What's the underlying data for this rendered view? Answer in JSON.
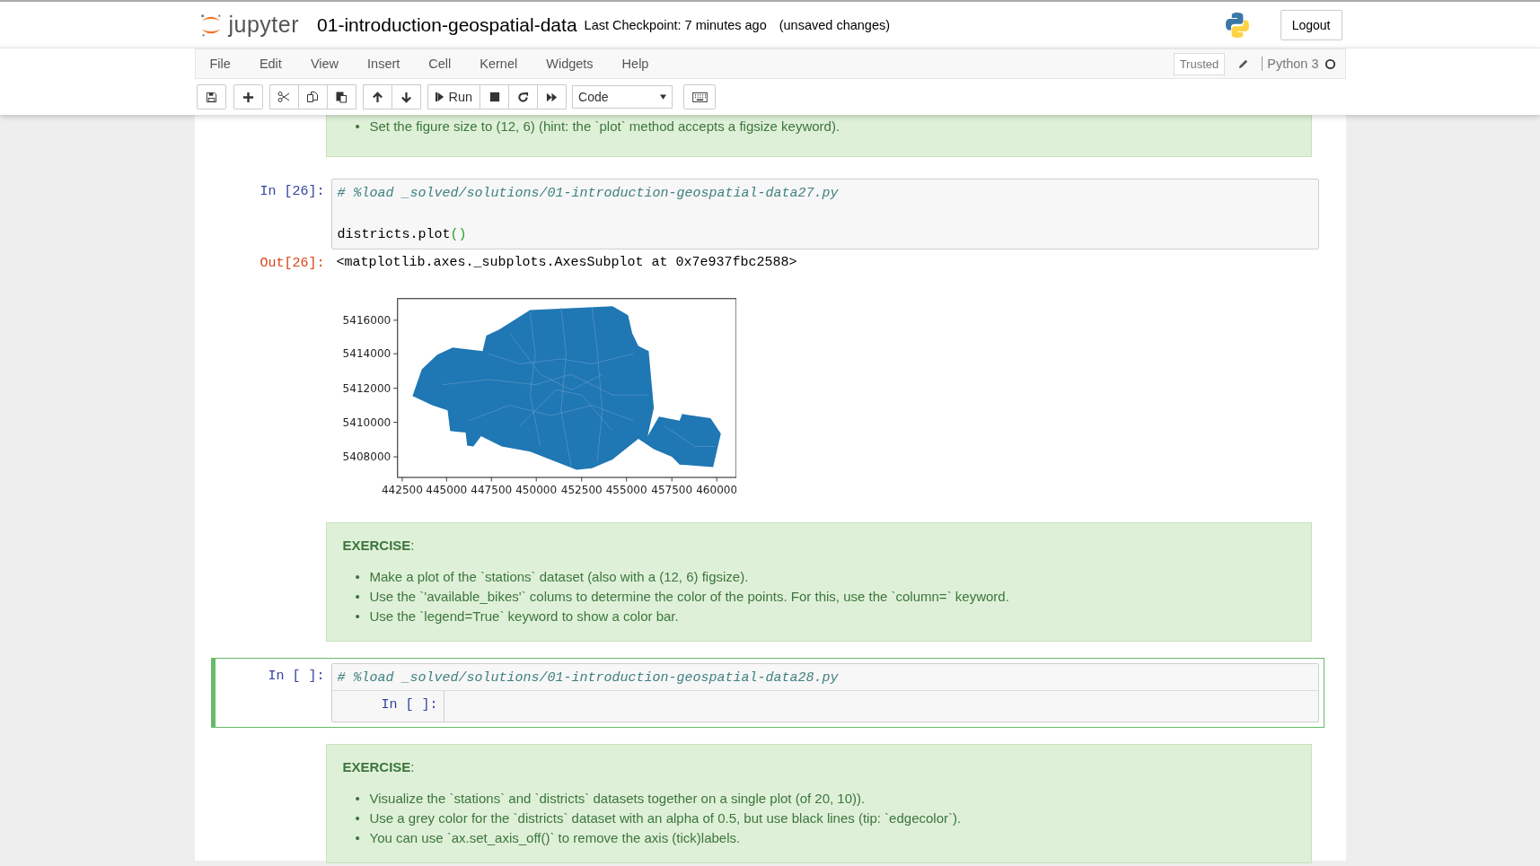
{
  "header": {
    "logo_text": "jupyter",
    "notebook_title": "01-introduction-geospatial-data",
    "checkpoint": "Last Checkpoint: 7 minutes ago",
    "unsaved": "(unsaved changes)",
    "logout": "Logout"
  },
  "menu": [
    "File",
    "Edit",
    "View",
    "Insert",
    "Cell",
    "Kernel",
    "Widgets",
    "Help"
  ],
  "kernel": {
    "trusted": "Trusted",
    "name": "Python 3",
    "busy": false
  },
  "toolbar": {
    "run": "Run",
    "cell_type": "Code"
  },
  "cells": [
    {
      "kind": "markdown",
      "selected": false,
      "bullets": [
        {
          "marker": "•",
          "text": "Set the figure size to (12, 6) (hint: the `plot` method accepts a figsize keyword)."
        }
      ]
    },
    {
      "kind": "code",
      "selected": false,
      "prompt": "In [26]:",
      "lines": [
        {
          "kind": "comment",
          "text": "# %load _solved/solutions/01-introduction-geospatial-data27.py"
        },
        {
          "kind": "blank"
        },
        {
          "kind": "code",
          "tokens": [
            {
              "kind": "name",
              "text": "districts.plot"
            },
            {
              "kind": "paren",
              "text": "()"
            }
          ]
        }
      ],
      "output": {
        "prompt": "Out[26]:",
        "text": "<matplotlib.axes._subplots.AxesSubplot at 0x7e937fbc2588>",
        "plot": {
          "yticks": [
            "5416000",
            "5414000",
            "5412000",
            "5410000",
            "5408000"
          ],
          "xticks": [
            "442500",
            "445000",
            "447500",
            "450000",
            "452500",
            "455000",
            "457500",
            "460000"
          ]
        }
      }
    },
    {
      "kind": "markdown",
      "selected": false,
      "heading": "**EXERCISE**:",
      "bullets": [
        {
          "marker": "•",
          "text": "Make a plot of the `stations` dataset (also with a (12, 6) figsize)."
        },
        {
          "marker": "•",
          "text": "Use the `'available_bikes'` colums to determine the color of the points. For this, use the `column=` keyword."
        },
        {
          "marker": "•",
          "text": "Use the `legend=True` keyword to show a color bar."
        }
      ]
    },
    {
      "kind": "code",
      "selected": true,
      "prompt": "In [ ]:",
      "lines": [
        {
          "kind": "comment",
          "text": "# %load _solved/solutions/01-introduction-geospatial-data28.py"
        }
      ],
      "inner_prompt": "In [ ]:"
    },
    {
      "kind": "markdown",
      "selected": false,
      "heading": "**EXERCISE**:",
      "bullets": [
        {
          "marker": "•",
          "text": "Visualize the `stations` and `districts` datasets together on a single plot (of 20, 10))."
        },
        {
          "marker": "•",
          "text": "Use a grey color for the `districts` dataset with an alpha of 0.5, but use black lines (tip: `edgecolor`)."
        },
        {
          "marker": "•",
          "text": "You can use `ax.set_axis_off()` to remove the axis (tick)labels."
        }
      ]
    }
  ]
}
